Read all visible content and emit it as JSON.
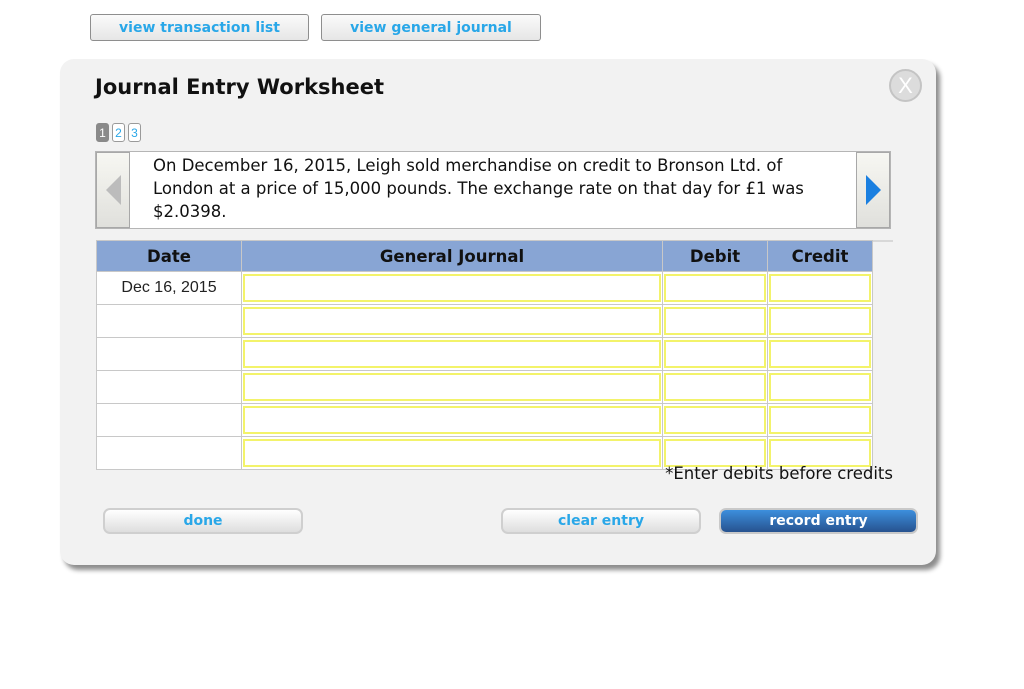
{
  "top_nav": {
    "view_transaction_list": "view transaction list",
    "view_general_journal": "view general journal"
  },
  "dialog": {
    "title": "Journal Entry Worksheet",
    "close_label": "X",
    "pages": [
      "1",
      "2",
      "3"
    ],
    "active_page": 1,
    "description": "On December 16, 2015, Leigh sold merchandise on credit to Bronson Ltd. of London at a price of 15,000 pounds. The exchange rate on that day for £1 was $2.0398.",
    "table": {
      "headers": [
        "Date",
        "General Journal",
        "Debit",
        "Credit"
      ],
      "rows": [
        {
          "date": "Dec 16, 2015",
          "account": "",
          "debit": "",
          "credit": ""
        },
        {
          "date": "",
          "account": "",
          "debit": "",
          "credit": ""
        },
        {
          "date": "",
          "account": "",
          "debit": "",
          "credit": ""
        },
        {
          "date": "",
          "account": "",
          "debit": "",
          "credit": ""
        },
        {
          "date": "",
          "account": "",
          "debit": "",
          "credit": ""
        },
        {
          "date": "",
          "account": "",
          "debit": "",
          "credit": ""
        }
      ]
    },
    "hint": "*Enter debits before credits",
    "buttons": {
      "done": "done",
      "clear_entry": "clear entry",
      "record_entry": "record entry"
    }
  },
  "colors": {
    "link_blue": "#29a7e8",
    "header_blue": "#88a5d4",
    "input_border_yellow": "#f3f36a",
    "primary_button": "#27528f",
    "next_arrow": "#1a7fe0"
  },
  "icons": {
    "prev": "triangle-left",
    "next": "triangle-right",
    "close": "x-circle"
  }
}
